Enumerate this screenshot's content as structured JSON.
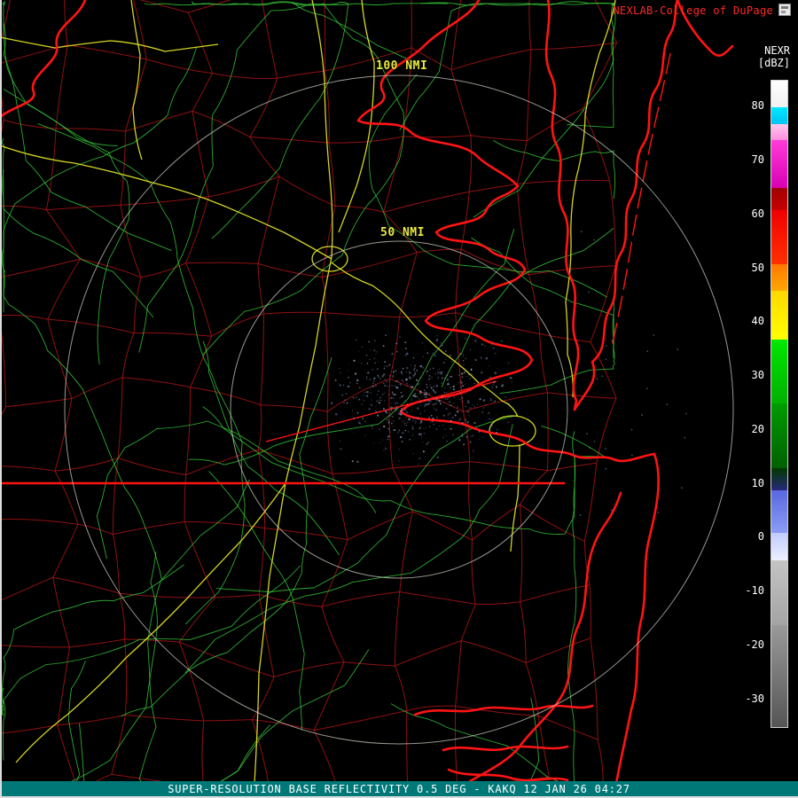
{
  "header": {
    "brand": "NEXLAB-College of DuPage",
    "brand_color": "#ff2828"
  },
  "colorbar": {
    "title": "NEXR",
    "units": "[dBZ]",
    "scale_top_dbz": 85,
    "scale_bottom_dbz": -35,
    "ticks": [
      80,
      70,
      60,
      50,
      40,
      30,
      20,
      10,
      0,
      -10,
      -20,
      -30
    ],
    "segments": [
      {
        "from": 85,
        "to": 80,
        "top": "#ffffff",
        "bottom": "#f0f0f0"
      },
      {
        "from": 80,
        "to": 77,
        "top": "#00e8ff",
        "bottom": "#00c4f0"
      },
      {
        "from": 77,
        "to": 74,
        "top": "#ffc8ec",
        "bottom": "#ff8ce0"
      },
      {
        "from": 74,
        "to": 65,
        "top": "#ff3cd8",
        "bottom": "#d800b4"
      },
      {
        "from": 65,
        "to": 61,
        "top": "#a00000",
        "bottom": "#c80000"
      },
      {
        "from": 61,
        "to": 51,
        "top": "#f00000",
        "bottom": "#ff3000"
      },
      {
        "from": 51,
        "to": 46,
        "top": "#ff7800",
        "bottom": "#ffa800"
      },
      {
        "from": 46,
        "to": 37,
        "top": "#ffd800",
        "bottom": "#ffff00"
      },
      {
        "from": 37,
        "to": 25,
        "top": "#00e800",
        "bottom": "#00b000"
      },
      {
        "from": 25,
        "to": 13,
        "top": "#009c00",
        "bottom": "#006000"
      },
      {
        "from": 13,
        "to": 9,
        "top": "#003800",
        "bottom": "#282878"
      },
      {
        "from": 9,
        "to": 1,
        "top": "#5868e0",
        "bottom": "#8c9cf4"
      },
      {
        "from": 1,
        "to": -4,
        "top": "#c0ccff",
        "bottom": "#ecf0ff"
      },
      {
        "from": -4,
        "to": -16,
        "top": "#c4c4c4",
        "bottom": "#a4a4a4"
      },
      {
        "from": -16,
        "to": -35,
        "top": "#9a9a9a",
        "bottom": "#555555"
      }
    ]
  },
  "map": {
    "ring_labels": [
      {
        "text": "100 NMI"
      },
      {
        "text": "50 NMI"
      }
    ],
    "colors": {
      "boundary": "#ff1414",
      "county": "#a81414",
      "road": "#38d23c",
      "highway": "#dede25",
      "ring": "#d8d8cc",
      "label": "#e8e840",
      "echo": "#8ea6cf"
    }
  },
  "footer": {
    "text": "SUPER-RESOLUTION BASE REFLECTIVITY 0.5 DEG - KAKQ 12 JAN 26 04:27",
    "background": "#007878"
  }
}
